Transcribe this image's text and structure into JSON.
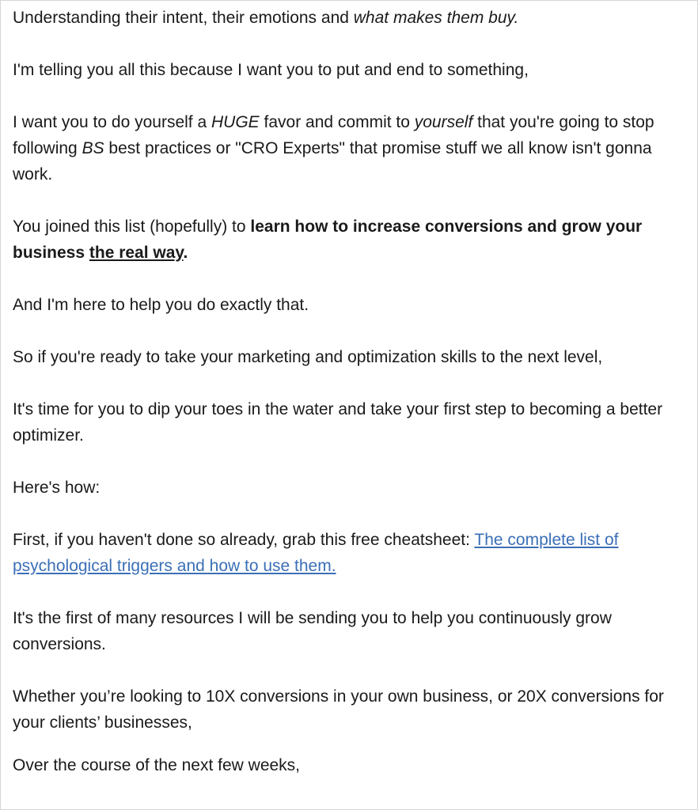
{
  "email": {
    "p1": {
      "text": "Understanding their intent, their emotions and ",
      "em": "what makes them buy."
    },
    "p2": {
      "text": "I'm telling you all this because I want you to put and end to something,"
    },
    "p3": {
      "a": "I want you to do yourself a ",
      "em1": "HUGE",
      "b": " favor and commit to ",
      "em2": "yourself",
      "c": " that you're going to stop following ",
      "em3": "BS",
      "d": " best practices or \"CRO Experts\" that promise stuff we all know isn't gonna work."
    },
    "p4": {
      "a": "You joined this list (hopefully) to ",
      "strong": "learn how to increase conversions and grow your business ",
      "strong_underlined": "the real way",
      "end": "."
    },
    "p5": {
      "text": "And I'm here to help you do exactly that."
    },
    "p6": {
      "text": "So if you're ready to take your marketing and optimization skills to the next level,"
    },
    "p7": {
      "text": "It's time for you to dip your toes in the water and take your first step to becoming a better optimizer."
    },
    "p8": {
      "text": "Here's how:"
    },
    "p9": {
      "text": "First, if you haven't done so already, grab this free cheatsheet: ",
      "link": "The complete list of psychological triggers and how to use them."
    },
    "p10": {
      "text": "It's the first of many resources I will be sending you to help you continuously grow conversions."
    },
    "p11": {
      "text": "Whether you’re looking to 10X conversions in your own business, or 20X conversions for your clients’ businesses,"
    },
    "p12": {
      "text": "Over the course of the next few weeks,"
    }
  },
  "colors": {
    "text": "#1a1a1a",
    "link": "#3b6fb6",
    "border": "#d6d6d6",
    "background": "#ffffff"
  }
}
